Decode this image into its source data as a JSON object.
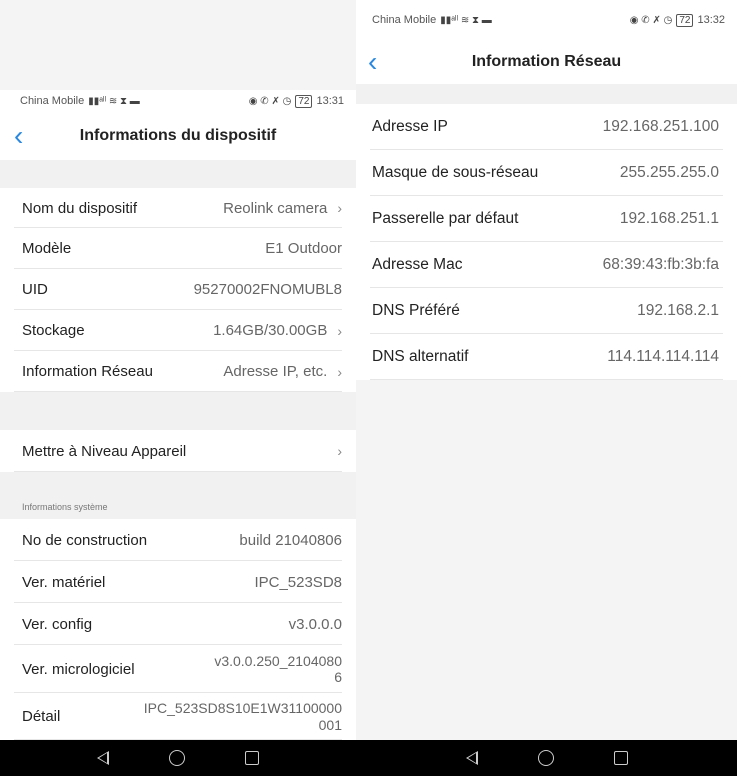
{
  "left": {
    "status": {
      "carrier": "China Mobile",
      "time": "13:31",
      "battery": "72"
    },
    "title": "Informations du dispositif",
    "rows_top": [
      {
        "label": "Nom du dispositif",
        "value": "Reolink camera",
        "chevron": true
      },
      {
        "label": "Modèle",
        "value": "E1 Outdoor",
        "chevron": false
      },
      {
        "label": "UID",
        "value": "95270002FNOMUBL8",
        "chevron": false
      },
      {
        "label": "Stockage",
        "value": "1.64GB/30.00GB",
        "chevron": true
      },
      {
        "label": "Information Réseau",
        "value": "Adresse IP, etc.",
        "chevron": true
      }
    ],
    "upgrade": {
      "label": "Mettre à Niveau Appareil"
    },
    "section_label": "Informations système",
    "rows_sys": [
      {
        "label": "No de construction",
        "value": "build 21040806"
      },
      {
        "label": "Ver. matériel",
        "value": "IPC_523SD8"
      },
      {
        "label": "Ver. config",
        "value": "v3.0.0.0"
      },
      {
        "label": "Ver. micrologiciel",
        "value": "v3.0.0.250_2104080\n6"
      },
      {
        "label": "Détail",
        "value": "IPC_523SD8S10E1W31100000\n001"
      }
    ]
  },
  "right": {
    "status": {
      "carrier": "China Mobile",
      "time": "13:32",
      "battery": "72"
    },
    "title": "Information Réseau",
    "rows": [
      {
        "label": "Adresse IP",
        "value": "192.168.251.100"
      },
      {
        "label": "Masque de sous-réseau",
        "value": "255.255.255.0"
      },
      {
        "label": "Passerelle par défaut",
        "value": "192.168.251.1"
      },
      {
        "label": "Adresse Mac",
        "value": "68:39:43:fb:3b:fa"
      },
      {
        "label": "DNS Préféré",
        "value": "192.168.2.1"
      },
      {
        "label": "DNS alternatif",
        "value": "114.114.114.114"
      }
    ]
  },
  "colors": {
    "accent": "#2a88e0",
    "background": "#f4f4f4",
    "navbar": "#000000"
  },
  "chevron": "›"
}
